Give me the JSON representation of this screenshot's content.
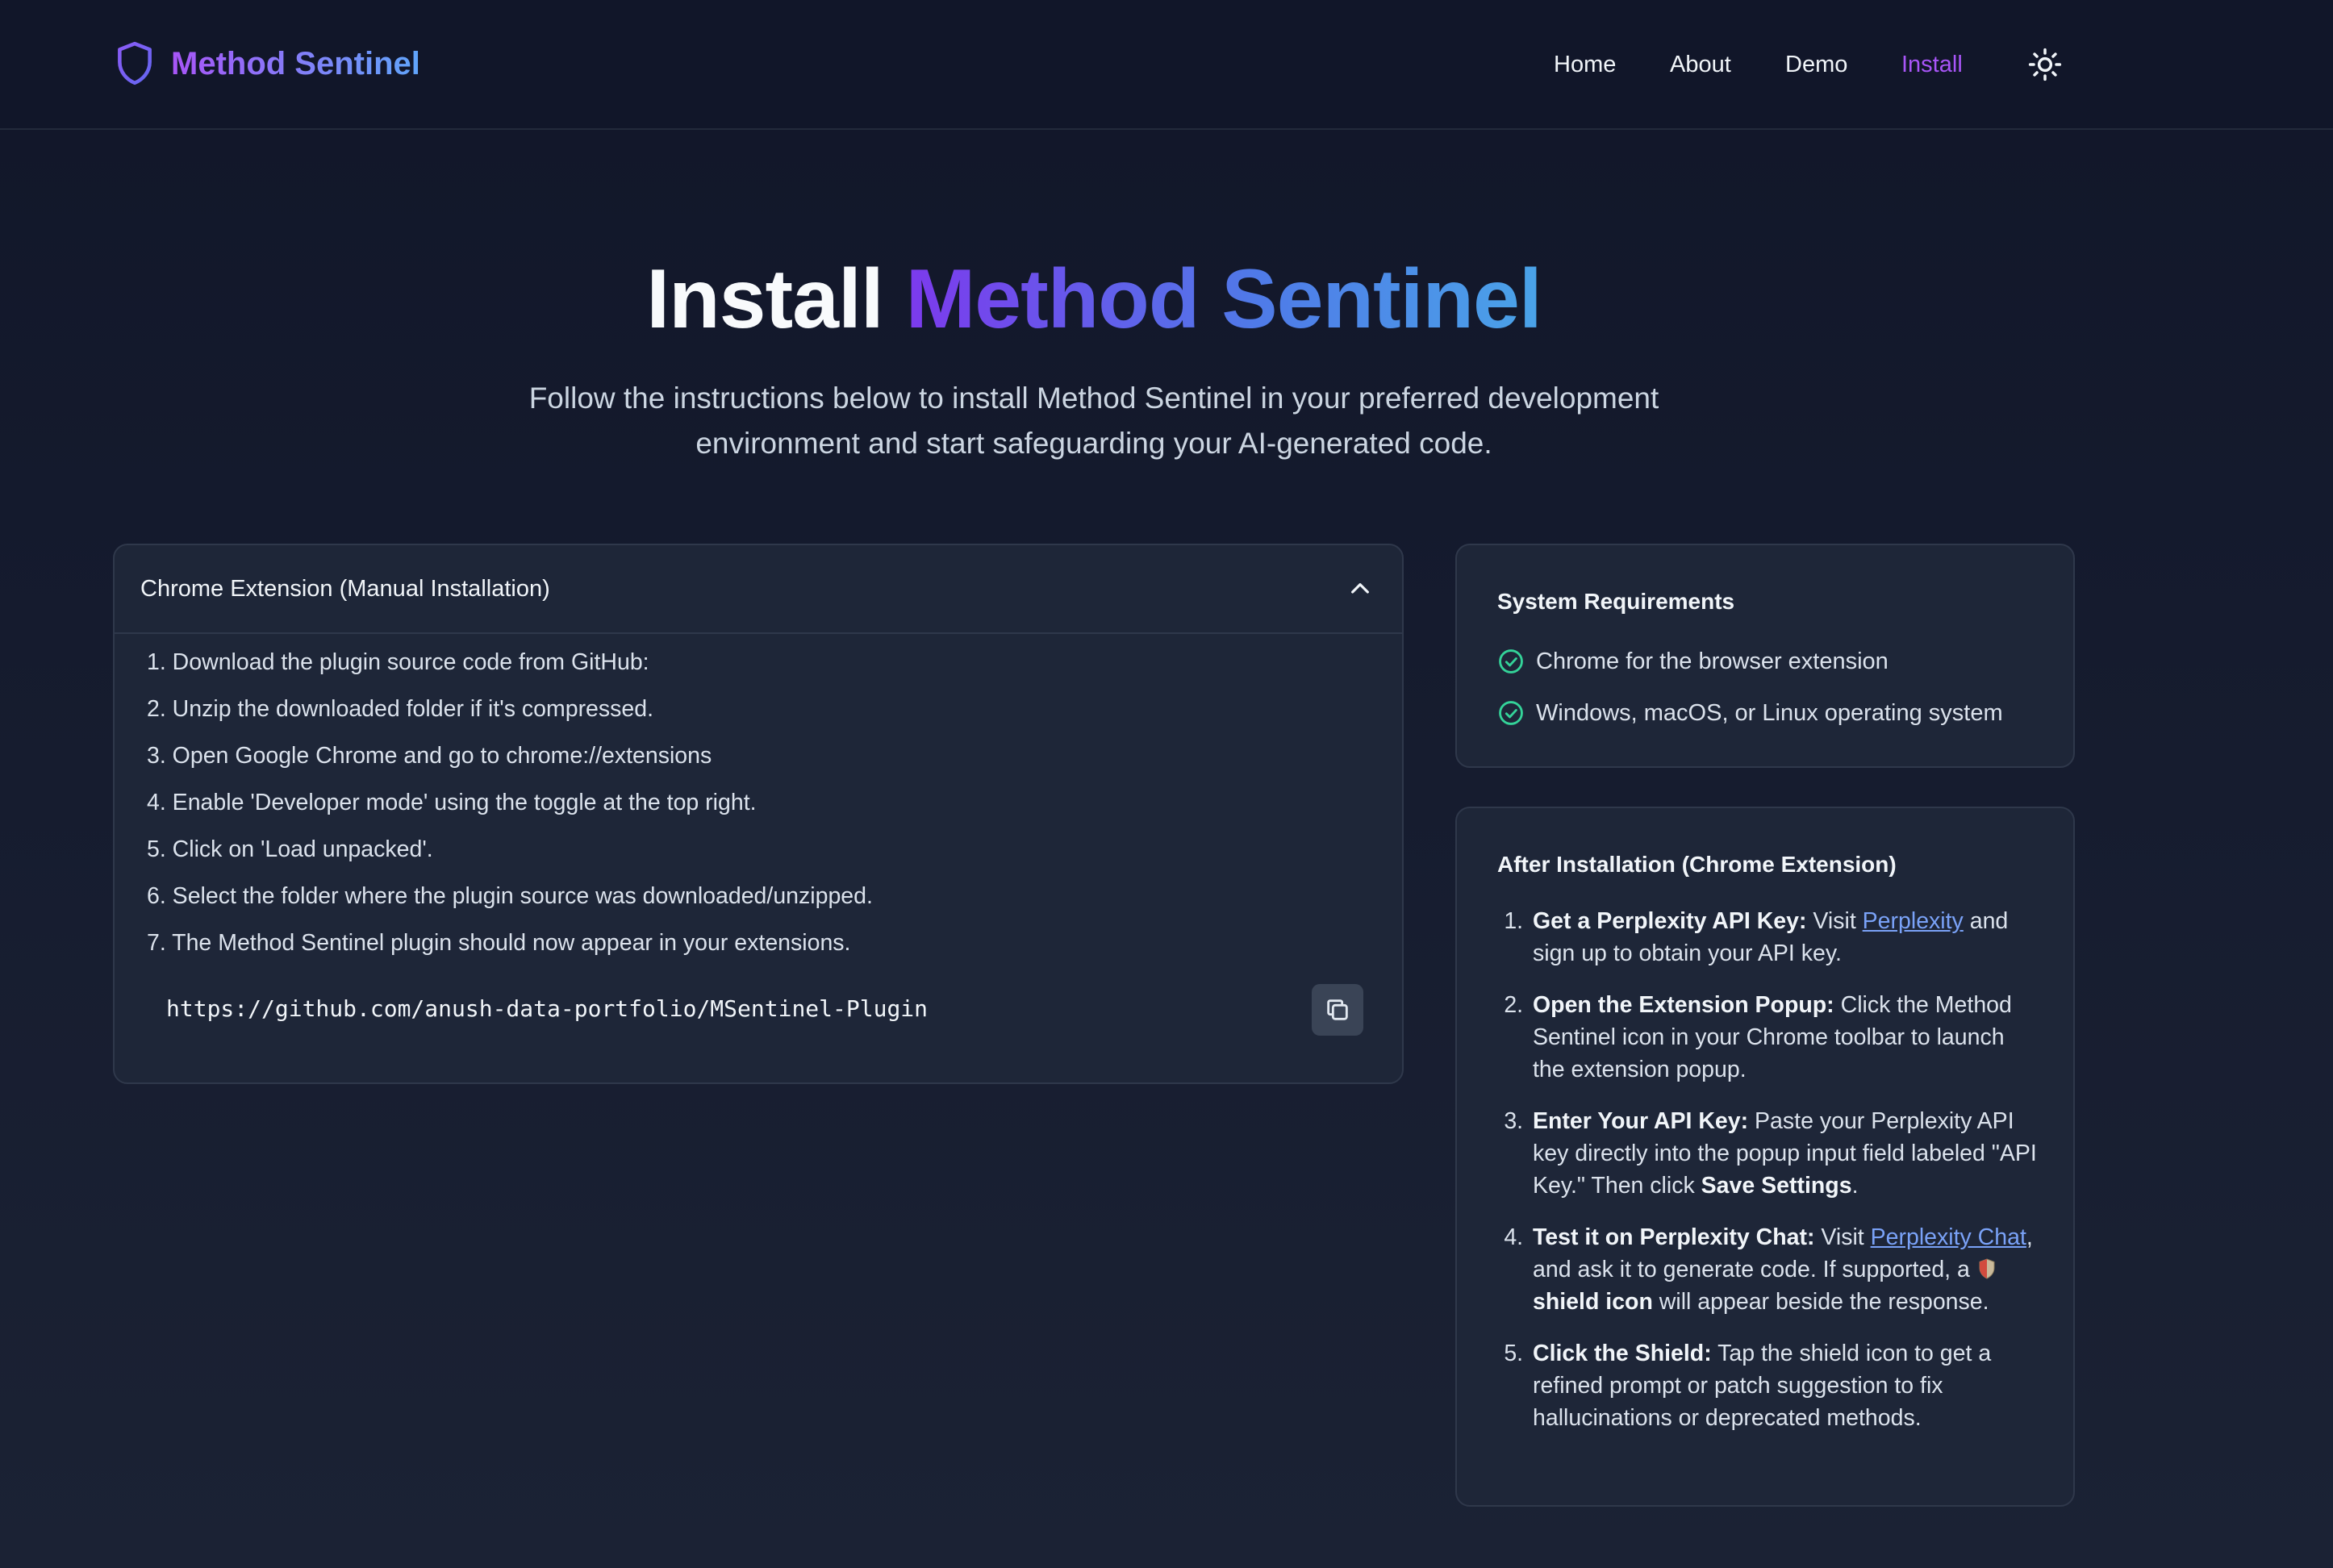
{
  "header": {
    "brand": "Method Sentinel",
    "nav": [
      {
        "label": "Home",
        "active": false
      },
      {
        "label": "About",
        "active": false
      },
      {
        "label": "Demo",
        "active": false
      },
      {
        "label": "Install",
        "active": true
      }
    ],
    "theme_icon": "sun-icon"
  },
  "hero": {
    "title_plain": "Install ",
    "title_highlight": "Method Sentinel",
    "subtitle_line1": "Follow the instructions below to install Method Sentinel in your preferred development",
    "subtitle_line2": "environment and start safeguarding your AI-generated code."
  },
  "install": {
    "title": "Chrome Extension (Manual Installation)",
    "expanded": true,
    "steps": [
      "1. Download the plugin source code from GitHub:",
      "2. Unzip the downloaded folder if it's compressed.",
      "3. Open Google Chrome and go to chrome://extensions",
      "4. Enable 'Developer mode' using the toggle at the top right.",
      "5. Click on 'Load unpacked'.",
      "6. Select the folder where the plugin source was downloaded/unzipped.",
      "7. The Method Sentinel plugin should now appear in your extensions."
    ],
    "repo_url": "https://github.com/anush-data-portfolio/MSentinel-Plugin"
  },
  "requirements": {
    "title": "System Requirements",
    "items": [
      "Chrome for the browser extension",
      "Windows, macOS, or Linux operating system"
    ]
  },
  "after": {
    "title": "After Installation (Chrome Extension)",
    "s1_bold": "Get a Perplexity API Key:",
    "s1_a": " Visit ",
    "s1_link": "Perplexity",
    "s1_b": " and sign up to obtain your API key.",
    "s2_bold": "Open the Extension Popup:",
    "s2_a": " Click the Method Sentinel icon in your Chrome toolbar to launch the extension popup.",
    "s3_bold": "Enter Your API Key:",
    "s3_a": " Paste your Perplexity API key directly into the popup input field labeled \"API Key.\" Then click ",
    "s3_bold2": "Save Settings",
    "s3_b": ".",
    "s4_bold": "Test it on Perplexity Chat:",
    "s4_a": " Visit ",
    "s4_link": "Perplexity Chat",
    "s4_b": ", and ask it to generate code. If supported, a ",
    "s4_bold2": "shield icon",
    "s4_c": " will appear beside the response.",
    "s5_bold": "Click the Shield:",
    "s5_a": " Tap the shield icon to get a refined prompt or patch suggestion to fix hallucinations or deprecated methods."
  },
  "colors": {
    "background": "#111629",
    "card": "#1e2638",
    "accent_purple": "#a855f7",
    "accent_blue": "#60a5fa",
    "link": "#7aa2f7",
    "check_green": "#34d399"
  }
}
